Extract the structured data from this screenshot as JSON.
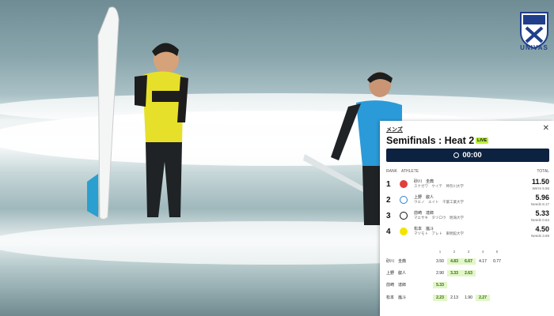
{
  "colors": {
    "panel_bg": "#ffffff",
    "timer_bg": "#0d2240",
    "live_badge": "#b9ef3c",
    "counted_wave_bg": "#e2f6c8",
    "rank1_badge": "#e0403a",
    "rank2_badge": "#2f7fd1",
    "rank3_badge": "#111111",
    "rank4_badge": "#f2e400"
  },
  "logo": {
    "icon": "univas-shield-icon",
    "text": "UNIVAS"
  },
  "panel": {
    "category": "メンズ",
    "close_icon": "close-icon",
    "title": "Semifinals : Heat 2",
    "live_label": "LIVE",
    "timer_icon": "clock-icon",
    "timer": "00:00",
    "headers": {
      "rank": "RANK",
      "athlete": "ATHLETE",
      "total": "TOTAL"
    },
    "rows": [
      {
        "rank": "1",
        "name": "砂川　圭典",
        "sub": "スナガワ　ケイテ　神奈川大学",
        "total": "11.50",
        "need": "We're 5.56"
      },
      {
        "rank": "2",
        "name": "上野　叡人",
        "sub": "ウエノ　エイト　千葉工業大学",
        "total": "5.96",
        "need": "Needs 8.17"
      },
      {
        "rank": "3",
        "name": "前崎　達郎",
        "sub": "マエサキ　タツロウ　明海大学",
        "total": "5.33",
        "need": "Needs 0.64"
      },
      {
        "rank": "4",
        "name": "松本　嵐斗",
        "sub": "マツモト　アレト　東明館大学",
        "total": "4.50",
        "need": "Needs 3.69"
      }
    ],
    "wave_headers": [
      "1",
      "2",
      "3",
      "4",
      "5"
    ],
    "waves": [
      {
        "name": "砂川　圭典",
        "scores": [
          {
            "v": "3.50",
            "g": false
          },
          {
            "v": "4.83",
            "g": true
          },
          {
            "v": "6.67",
            "g": true
          },
          {
            "v": "4.17",
            "g": false
          },
          {
            "v": "0.77",
            "g": false
          }
        ]
      },
      {
        "name": "上野　叡人",
        "scores": [
          {
            "v": "2.90",
            "g": false
          },
          {
            "v": "3.33",
            "g": true
          },
          {
            "v": "2.63",
            "g": true
          }
        ]
      },
      {
        "name": "前崎　達郎",
        "scores": [
          {
            "v": "5.33",
            "g": true
          }
        ]
      },
      {
        "name": "松本　嵐斗",
        "scores": [
          {
            "v": "2.23",
            "g": true
          },
          {
            "v": "2.13",
            "g": false
          },
          {
            "v": "1.90",
            "g": false
          },
          {
            "v": "2.27",
            "g": true
          }
        ]
      }
    ]
  }
}
